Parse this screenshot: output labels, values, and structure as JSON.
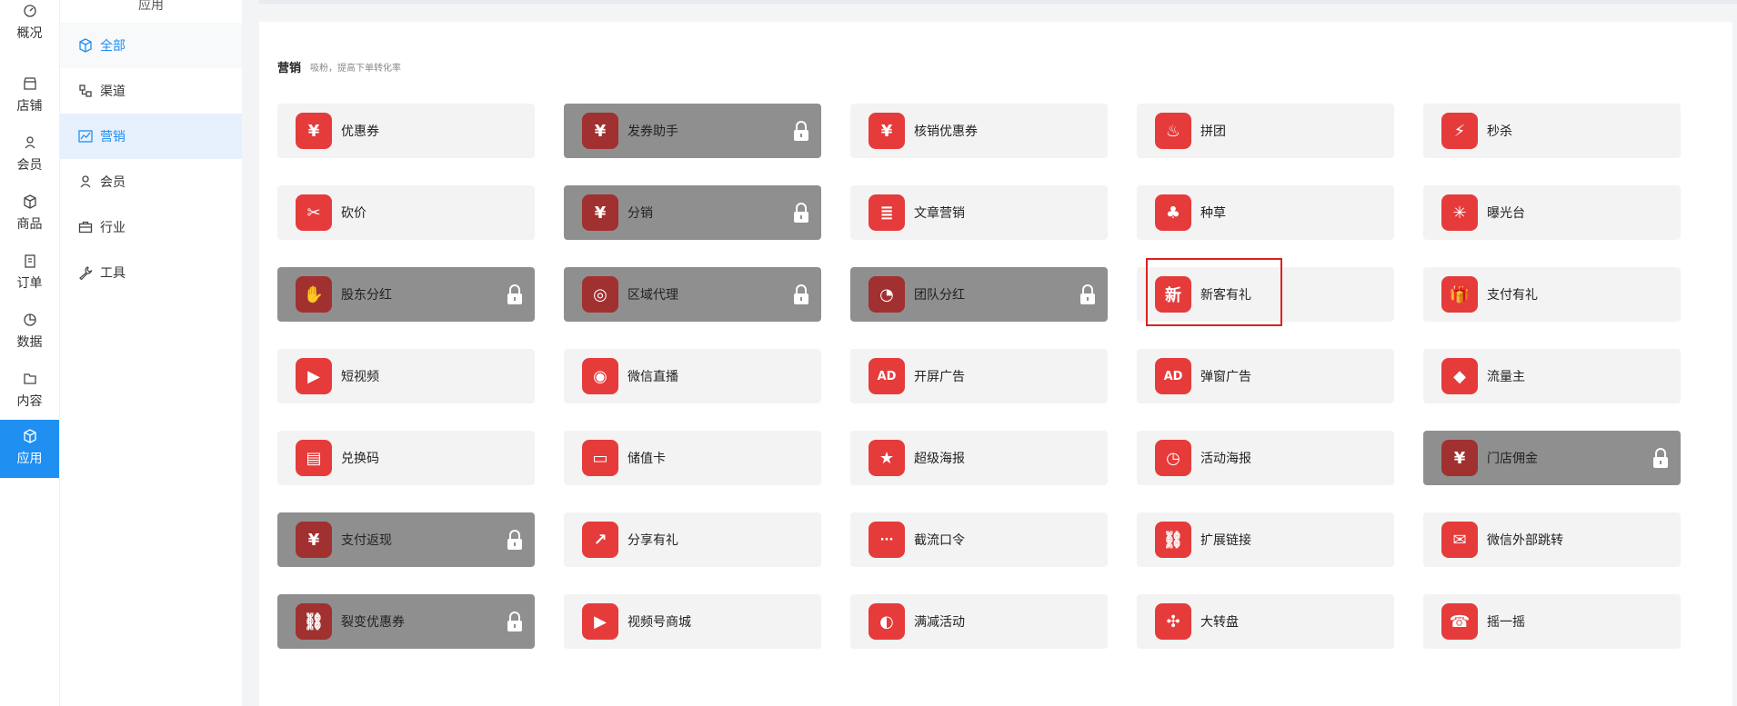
{
  "rail": {
    "items": [
      {
        "label": "概况",
        "icon": "dashboard-icon"
      },
      {
        "label": "店铺",
        "icon": "store-icon"
      },
      {
        "label": "会员",
        "icon": "member-icon"
      },
      {
        "label": "商品",
        "icon": "box-icon"
      },
      {
        "label": "订单",
        "icon": "clipboard-icon"
      },
      {
        "label": "数据",
        "icon": "pie-icon"
      },
      {
        "label": "内容",
        "icon": "folder-icon"
      },
      {
        "label": "应用",
        "icon": "cube-icon",
        "active": true
      }
    ]
  },
  "subnav": {
    "heading": "应用",
    "items": [
      {
        "label": "全部",
        "icon": "cube-icon"
      },
      {
        "label": "渠道",
        "icon": "channel-icon"
      },
      {
        "label": "营销",
        "icon": "trend-icon",
        "active": true
      },
      {
        "label": "会员",
        "icon": "user-icon"
      },
      {
        "label": "行业",
        "icon": "briefcase-icon"
      },
      {
        "label": "工具",
        "icon": "wrench-icon"
      }
    ]
  },
  "section": {
    "title": "营销",
    "subtitle": "吸粉，提高下单转化率"
  },
  "cards": [
    {
      "label": "优惠券",
      "glyph": "¥",
      "locked": false
    },
    {
      "label": "发券助手",
      "glyph": "¥",
      "locked": true
    },
    {
      "label": "核销优惠券",
      "glyph": "¥",
      "locked": false
    },
    {
      "label": "拼团",
      "glyph": "♨",
      "locked": false
    },
    {
      "label": "秒杀",
      "glyph": "⚡",
      "locked": false
    },
    {
      "label": "砍价",
      "glyph": "✂",
      "locked": false
    },
    {
      "label": "分销",
      "glyph": "¥",
      "locked": true
    },
    {
      "label": "文章营销",
      "glyph": "≣",
      "locked": false
    },
    {
      "label": "种草",
      "glyph": "♣",
      "locked": false
    },
    {
      "label": "曝光台",
      "glyph": "✳",
      "locked": false
    },
    {
      "label": "股东分红",
      "glyph": "✋",
      "locked": true
    },
    {
      "label": "区域代理",
      "glyph": "◎",
      "locked": true
    },
    {
      "label": "团队分红",
      "glyph": "◔",
      "locked": true
    },
    {
      "label": "新客有礼",
      "glyph": "新",
      "locked": false
    },
    {
      "label": "支付有礼",
      "glyph": "🎁",
      "locked": false
    },
    {
      "label": "短视频",
      "glyph": "▶",
      "locked": false
    },
    {
      "label": "微信直播",
      "glyph": "◉",
      "locked": false
    },
    {
      "label": "开屏广告",
      "glyph": "AD",
      "locked": false
    },
    {
      "label": "弹窗广告",
      "glyph": "AD",
      "locked": false
    },
    {
      "label": "流量主",
      "glyph": "◆",
      "locked": false
    },
    {
      "label": "兑换码",
      "glyph": "▤",
      "locked": false
    },
    {
      "label": "储值卡",
      "glyph": "▭",
      "locked": false
    },
    {
      "label": "超级海报",
      "glyph": "★",
      "locked": false
    },
    {
      "label": "活动海报",
      "glyph": "◷",
      "locked": false
    },
    {
      "label": "门店佣金",
      "glyph": "¥",
      "locked": true
    },
    {
      "label": "支付返现",
      "glyph": "¥",
      "locked": true
    },
    {
      "label": "分享有礼",
      "glyph": "↗",
      "locked": false
    },
    {
      "label": "截流口令",
      "glyph": "···",
      "locked": false
    },
    {
      "label": "扩展链接",
      "glyph": "⛓",
      "locked": false
    },
    {
      "label": "微信外部跳转",
      "glyph": "✉",
      "locked": false
    },
    {
      "label": "裂变优惠券",
      "glyph": "⛓",
      "locked": true
    },
    {
      "label": "视频号商城",
      "glyph": "▶",
      "locked": false
    },
    {
      "label": "满减活动",
      "glyph": "◐",
      "locked": false
    },
    {
      "label": "大转盘",
      "glyph": "✣",
      "locked": false
    },
    {
      "label": "摇一摇",
      "glyph": "☎",
      "locked": false
    }
  ],
  "colors": {
    "accent": "#1f8ff2",
    "icon_red": "#e63b3b",
    "locked_bg": "#8f8f8f",
    "highlight": "#e02020"
  }
}
